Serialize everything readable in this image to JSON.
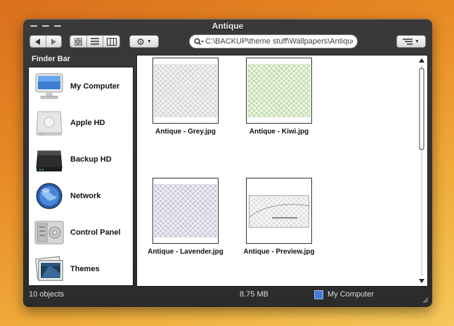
{
  "window": {
    "title": "Antique"
  },
  "toolbar": {
    "back_icon": "left-arrow-icon",
    "forward_icon": "right-arrow-icon",
    "view_modes": [
      "icon-view-icon",
      "list-view-icon",
      "column-view-icon"
    ],
    "action_icon": "gear-icon",
    "search_value": "C:\\BACKUP\\theme stuff\\Wallpapers\\Antique",
    "arrange_icon": "arrange-icon"
  },
  "sidebar": {
    "header": "Finder Bar",
    "items": [
      {
        "label": "My Computer",
        "icon": "computer-icon"
      },
      {
        "label": "Apple HD",
        "icon": "drive-icon"
      },
      {
        "label": "Backup HD",
        "icon": "drive-dark-icon"
      },
      {
        "label": "Network",
        "icon": "globe-icon"
      },
      {
        "label": "Control Panel",
        "icon": "control-panel-icon"
      },
      {
        "label": "Themes",
        "icon": "themes-icon"
      }
    ]
  },
  "files": [
    {
      "name": "Antique - Grey.jpg",
      "color": "#c8c8c8"
    },
    {
      "name": "Antique - Kiwi.jpg",
      "color": "#b8d4a0"
    },
    {
      "name": "Antique - Lavender.jpg",
      "color": "#c4bfd4"
    },
    {
      "name": "Antique - Preview.jpg",
      "color": "#d4d4d4"
    }
  ],
  "status": {
    "count": "10 objects",
    "size": "8.75 MB",
    "location": "My Computer"
  }
}
